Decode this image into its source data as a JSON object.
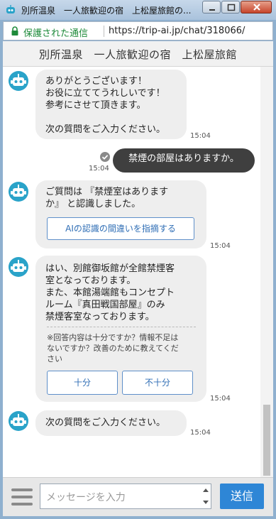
{
  "window": {
    "title": "別所温泉　一人旅歓迎の宿　上松屋旅館の...",
    "controls": {
      "minimize_icon": "minimize-icon",
      "maximize_icon": "maximize-icon",
      "close_icon": "close-icon"
    }
  },
  "addressbar": {
    "secure_label": "保護された通信",
    "url": "https://trip-ai.jp/chat/318066/"
  },
  "header": {
    "title": "別所温泉　一人旅歓迎の宿　上松屋旅館"
  },
  "messages": [
    {
      "from": "bot",
      "lines": [
        "ありがとうございます！",
        "お役に立ててうれしいです！",
        "参考にさせて頂きます。",
        "",
        "次の質問をご入力ください。"
      ],
      "time": "15:04"
    },
    {
      "from": "user",
      "text": "禁煙の部屋はありますか。",
      "time": "15:04"
    },
    {
      "from": "bot",
      "lines": [
        "ご質問は 『禁煙室はありますか』 と認識しました。"
      ],
      "lines_display": [
        "ご質問は 『禁煙室はあります",
        "か』 と認識しました。"
      ],
      "button": "AIの認識の間違いを指摘する",
      "time": "15:04"
    },
    {
      "from": "bot",
      "lines": [
        "はい、別館御坂館が全館禁煙客",
        "室となっております。",
        "また、本館湯端館もコンセプト",
        "ルーム『真田戦国部屋』のみ",
        "禁煙客室なっております。"
      ],
      "note": [
        "※回答内容は十分ですか？情報不足は",
        "ないですか？改善のために教えてくだ",
        "さい"
      ],
      "buttons": [
        "十分",
        "不十分"
      ],
      "time": "15:04"
    },
    {
      "from": "bot",
      "lines": [
        "次の質問をご入力ください。"
      ],
      "time": "15:04"
    }
  ],
  "input": {
    "placeholder": "メッセージを入力"
  },
  "send_label": "送信",
  "colors": {
    "accent": "#2e86d6",
    "user_bubble": "#3f3f3f",
    "bot_bubble": "#eeeeee",
    "secure": "#1e8a3a"
  }
}
